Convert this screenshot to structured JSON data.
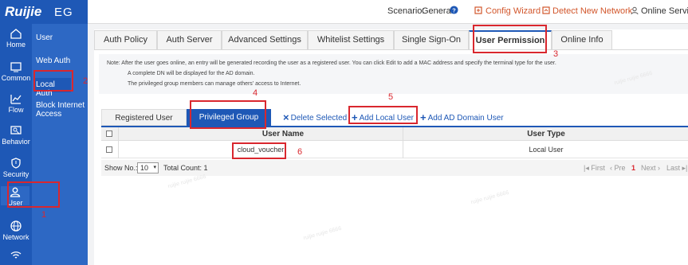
{
  "brand": {
    "logo": "Ruijie",
    "product": "EG"
  },
  "topbar": {
    "scenario_label": "Scenario:",
    "scenario_value": "General",
    "config_wizard": "Config Wizard",
    "detect_network": "Detect New Network",
    "online_service": "Online Service"
  },
  "rail": [
    {
      "label": "Home",
      "icon": "home-icon"
    },
    {
      "label": "Common",
      "icon": "common-icon"
    },
    {
      "label": "Flow",
      "icon": "flow-icon"
    },
    {
      "label": "Behavior",
      "icon": "behavior-icon"
    },
    {
      "label": "Security",
      "icon": "shield-icon"
    },
    {
      "label": "User",
      "icon": "user-icon"
    },
    {
      "label": "Network",
      "icon": "network-icon"
    }
  ],
  "submenu": [
    "User",
    "Web Auth",
    "Local Auth",
    "Block Internet Access"
  ],
  "tabs": [
    "Auth Policy",
    "Auth Server",
    "Advanced Settings",
    "Whitelist Settings",
    "Single Sign-On",
    "User Permission",
    "Online Info"
  ],
  "note": {
    "line1": "Note: After the user goes online, an entry will be generated recording the user as a registered user. You can click Edit to add a MAC address and specify the terminal type for the user.",
    "line2": "A complete DN will be displayed for the AD domain.",
    "line3": "The privileged group members can manage others' access to Internet."
  },
  "subtabs": {
    "registered": "Registered User",
    "privileged": "Privileged Group"
  },
  "actions": {
    "delete": "Delete Selected",
    "add_local": "Add Local User",
    "add_ad": "Add AD Domain User"
  },
  "table": {
    "headers": [
      "User Name",
      "User Type"
    ],
    "rows": [
      {
        "name": "cloud_voucher",
        "type": "Local User"
      }
    ]
  },
  "footer": {
    "show_no": "Show No.:",
    "page_size": "10",
    "total": "Total Count: 1",
    "first": "First",
    "prev": "Pre",
    "page": "1",
    "next": "Next",
    "last": "Last"
  },
  "annotations": [
    "1",
    "2",
    "3",
    "4",
    "5",
    "6"
  ],
  "watermark": "ruijie ruijie 6666",
  "colors": {
    "brand_blue": "#1e58b6",
    "accent_orange": "#d2562b",
    "annotation_red": "#d9272e"
  }
}
